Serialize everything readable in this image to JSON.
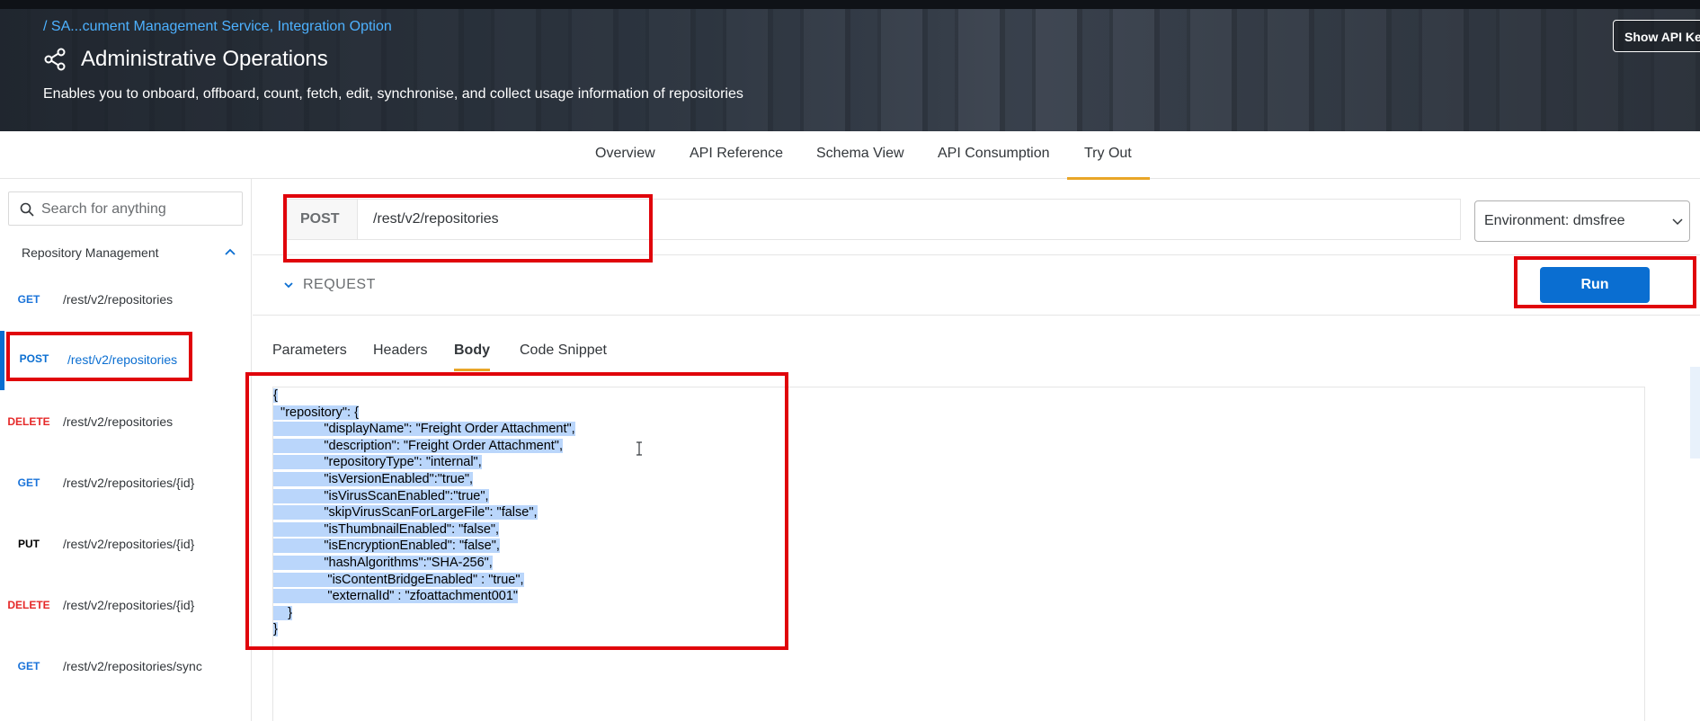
{
  "header": {
    "breadcrumb": "/ SA...cument Management Service, Integration Option",
    "title": "Administrative Operations",
    "subtitle": "Enables you to onboard, offboard, count, fetch, edit, synchronise, and collect usage information of repositories",
    "show_api_key_label": "Show API Key"
  },
  "tabs": [
    "Overview",
    "API Reference",
    "Schema View",
    "API Consumption",
    "Try Out"
  ],
  "active_tab": "Try Out",
  "sidebar": {
    "search_placeholder": "Search for anything",
    "group_label": "Repository Management",
    "items": [
      {
        "method": "GET",
        "path": "/rest/v2/repositories"
      },
      {
        "method": "POST",
        "path": "/rest/v2/repositories"
      },
      {
        "method": "DELETE",
        "path": "/rest/v2/repositories"
      },
      {
        "method": "GET",
        "path": "/rest/v2/repositories/{id}"
      },
      {
        "method": "PUT",
        "path": "/rest/v2/repositories/{id}"
      },
      {
        "method": "DELETE",
        "path": "/rest/v2/repositories/{id}"
      },
      {
        "method": "GET",
        "path": "/rest/v2/repositories/sync"
      }
    ]
  },
  "request_bar": {
    "method": "POST",
    "url": "/rest/v2/repositories",
    "environment": "Environment: dmsfree"
  },
  "request": {
    "section_label": "REQUEST",
    "run_label": "Run",
    "subtabs": [
      "Parameters",
      "Headers",
      "Body",
      "Code Snippet"
    ],
    "active_subtab": "Body",
    "body_lines": [
      "{",
      "  \"repository\": {",
      "              \"displayName\": \"Freight Order Attachment\",",
      "              \"description\": \"Freight Order Attachment\",",
      "              \"repositoryType\": \"internal\",",
      "              \"isVersionEnabled\":\"true\",",
      "              \"isVirusScanEnabled\":\"true\",",
      "              \"skipVirusScanForLargeFile\": \"false\",",
      "              \"isThumbnailEnabled\": \"false\",",
      "              \"isEncryptionEnabled\": \"false\",",
      "              \"hashAlgorithms\":\"SHA-256\",",
      "               \"isContentBridgeEnabled\" : \"true\",",
      "               \"externalId\" : \"zfoattachment001\"",
      "    }",
      "}"
    ]
  },
  "colors": {
    "accent_blue": "#0a6ed1",
    "tab_underline": "#e9a628",
    "highlight_red": "#e0040b",
    "delete_red": "#e52929",
    "selection": "#bad6fb"
  }
}
